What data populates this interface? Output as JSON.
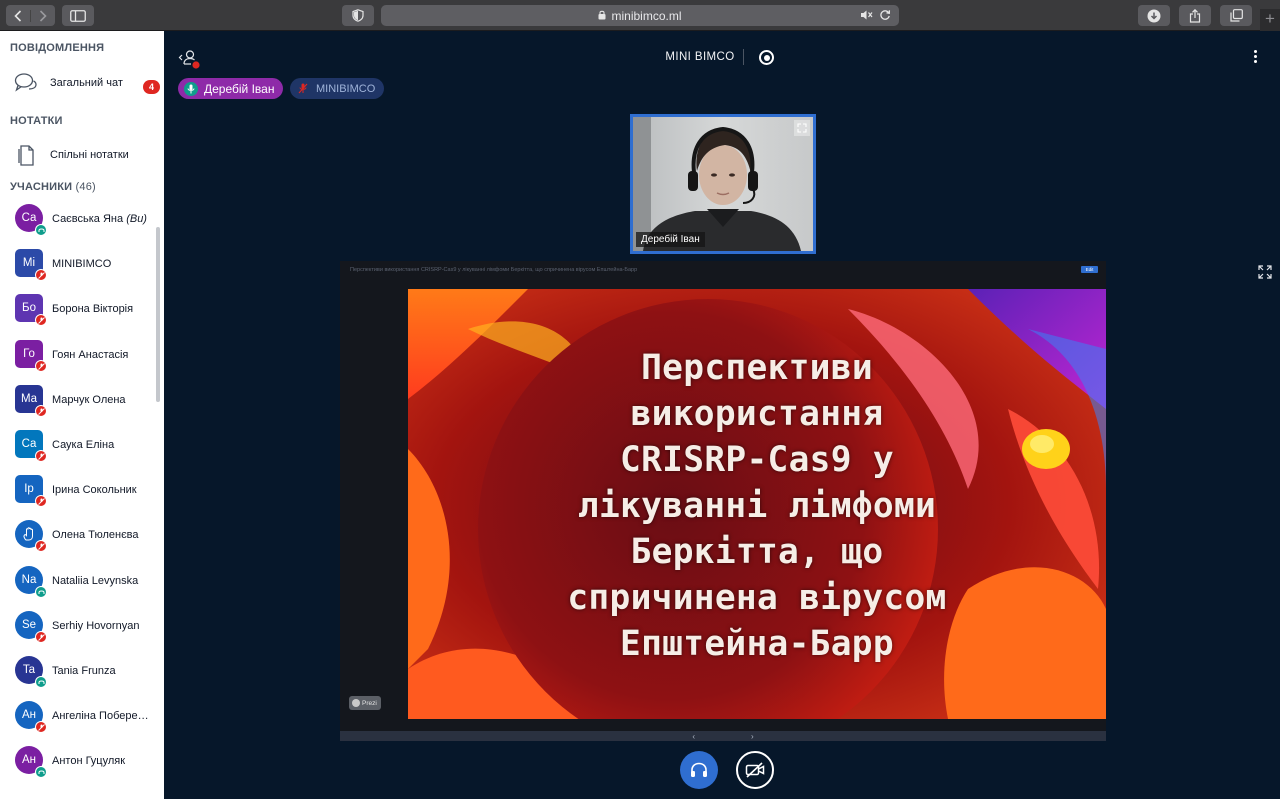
{
  "browser": {
    "url": "minibimco.ml",
    "icons": [
      "back-arrow-icon",
      "forward-arrow-icon",
      "sidebar-toggle-icon",
      "shield-icon",
      "lock-icon",
      "mute-icon",
      "reload-icon",
      "download-icon",
      "share-icon",
      "tabs-icon",
      "new-tab-icon"
    ],
    "new_tab_label": "+"
  },
  "sidebar": {
    "messages_heading": "ПОВІДОМЛЕННЯ",
    "public_chat_label": "Загальний чат",
    "public_chat_badge": "4",
    "notes_heading": "НОТАТКИ",
    "shared_notes_label": "Спільні нотатки",
    "users_heading": "УЧАСНИКИ",
    "users_count": "(46)",
    "users": [
      {
        "initials": "Са",
        "name": "Саєвська Яна",
        "you": "(Ви)",
        "color": "#7b1fa2",
        "status": "listen",
        "shape": "circle"
      },
      {
        "initials": "Mi",
        "name": "MINIBIMCO",
        "you": "",
        "color": "#2c4aa8",
        "status": "muted",
        "shape": "square"
      },
      {
        "initials": "Бо",
        "name": "Борона Вікторія",
        "you": "",
        "color": "#5e35b1",
        "status": "muted",
        "shape": "square"
      },
      {
        "initials": "Го",
        "name": "Гоян Анастасія",
        "you": "",
        "color": "#7b1fa2",
        "status": "muted",
        "shape": "square"
      },
      {
        "initials": "Ма",
        "name": "Марчук Олена",
        "you": "",
        "color": "#283593",
        "status": "muted",
        "shape": "square"
      },
      {
        "initials": "Са",
        "name": "Саука Еліна",
        "you": "",
        "color": "#0277bd",
        "status": "muted",
        "shape": "square"
      },
      {
        "initials": "Ір",
        "name": "Ірина Сокольник",
        "you": "",
        "color": "#1565c0",
        "status": "muted",
        "shape": "square"
      },
      {
        "initials": "",
        "name": "Олена Тюленєва",
        "you": "",
        "color": "#1565c0",
        "status": "muted",
        "shape": "circle",
        "icon": "raised-hand-icon"
      },
      {
        "initials": "Na",
        "name": "Nataliia Levynska",
        "you": "",
        "color": "#1565c0",
        "status": "listen",
        "shape": "circle"
      },
      {
        "initials": "Se",
        "name": "Serhiy Hovornyan",
        "you": "",
        "color": "#1565c0",
        "status": "muted",
        "shape": "circle"
      },
      {
        "initials": "Ta",
        "name": "Tania Frunza",
        "you": "",
        "color": "#283593",
        "status": "listen",
        "shape": "circle"
      },
      {
        "initials": "Ан",
        "name": "Ангеліна Побере…",
        "you": "",
        "color": "#1565c0",
        "status": "muted",
        "shape": "circle"
      },
      {
        "initials": "Ан",
        "name": "Антон Гуцуляк",
        "you": "",
        "color": "#7b1fa2",
        "status": "listen",
        "shape": "circle"
      }
    ],
    "colors": {
      "listen": "#0f9d8c",
      "muted": "#df2721"
    }
  },
  "main": {
    "meeting_title": "MINI BIMCO",
    "talkers": [
      {
        "name": "Деребій Іван",
        "color": "#8e2aa8",
        "icon": "microphone-icon"
      },
      {
        "name": "MINIBIMCO",
        "color": "#1f3566",
        "icon": "microphone-muted-icon"
      }
    ],
    "webcam_name": "Деребій Іван",
    "slide": {
      "header_text": "Перспективи використання CRISRP-Cas9 у лікуванні лімфоми Беркітта, що спричинена вірусом Епштейна-Барр",
      "edit_label": "Edit",
      "lines": [
        "Перспективи",
        "використання",
        "CRISRP-Cas9 у",
        "лікуванні лімфоми",
        "Беркітта, що",
        "спричинена вірусом",
        "Епштейна-Барр"
      ],
      "prezi_label": "Prezi",
      "nav_prev": "‹",
      "nav_next": "›"
    },
    "accent_color": "#2f6ed0"
  }
}
